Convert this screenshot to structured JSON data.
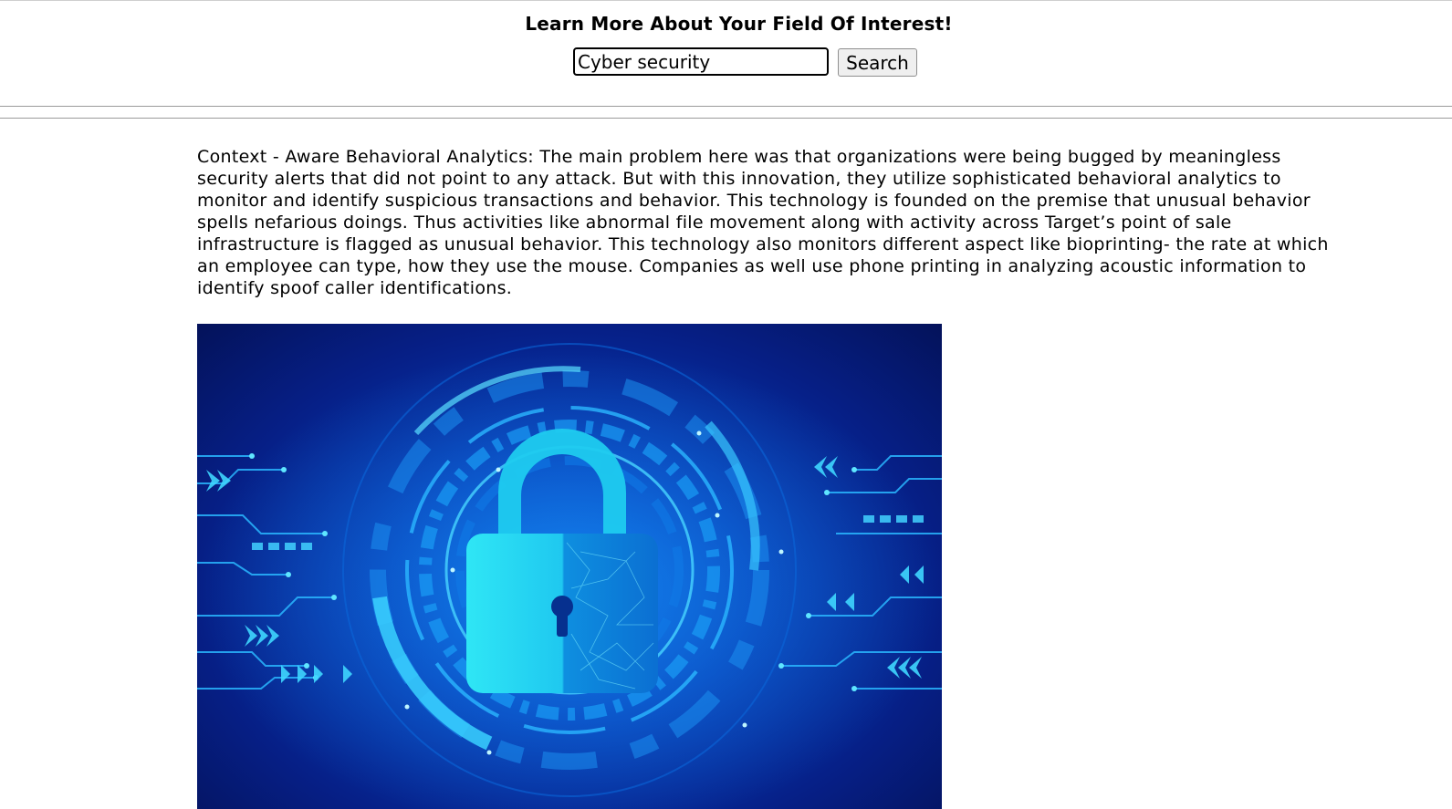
{
  "header": {
    "title": "Learn More About Your Field Of Interest!"
  },
  "search": {
    "value": "Cyber security",
    "button_label": "Search"
  },
  "article": {
    "paragraph": "Context - Aware Behavioral Analytics: The main problem here was that organizations were being bugged by meaningless security alerts that did not point to any attack. But with this innovation, they utilize sophisticated behavioral analytics to monitor and identify suspicious transactions and behavior. This technology is founded on the premise that unusual behavior spells nefarious doings. Thus activities like abnormal file movement along with activity across Target’s point of sale infrastructure is flagged as unusual behavior. This technology also monitors different aspect like bioprinting- the rate at which an employee can type, how they use the mouse. Companies as well use phone printing in analyzing acoustic information to identify spoof caller identifications."
  },
  "hero": {
    "icon": "padlock-icon",
    "colors": {
      "bg_dark": "#04125a",
      "bg_mid": "#073bb8",
      "glow": "#19c8ff",
      "lock": "#22d7f0"
    }
  }
}
